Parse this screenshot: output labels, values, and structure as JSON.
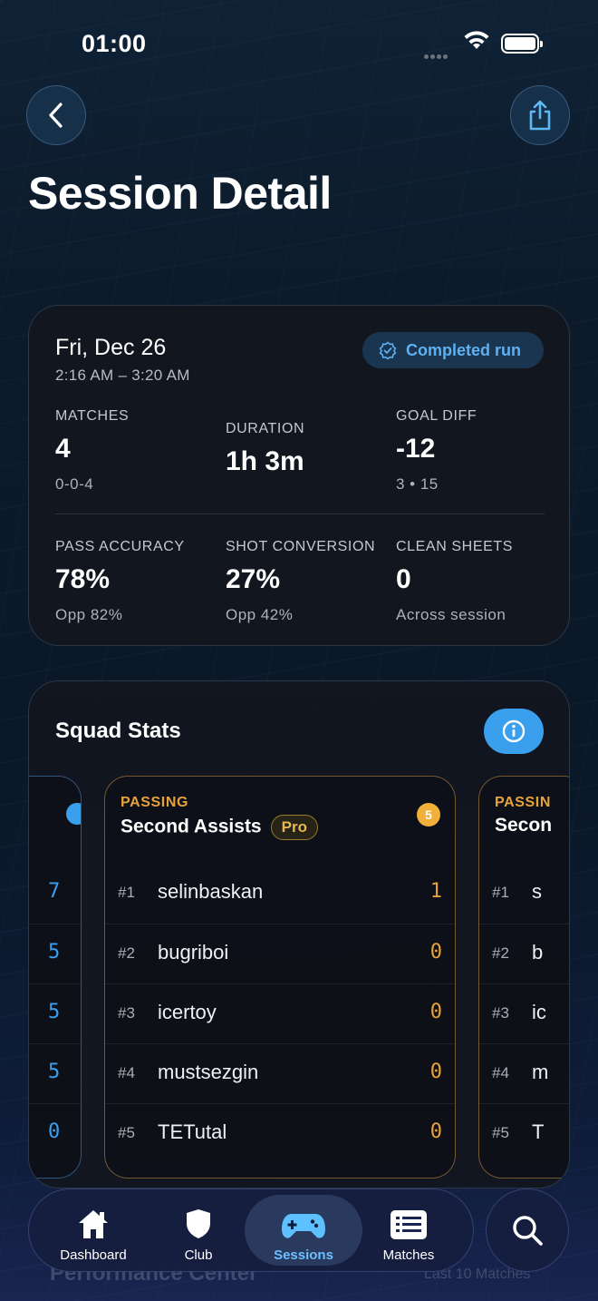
{
  "status_bar": {
    "time": "01:00"
  },
  "header": {
    "title": "Session Detail",
    "back_icon": "chevron-left-icon",
    "share_icon": "share-icon"
  },
  "summary": {
    "date": "Fri, Dec 26",
    "time_range": "2:16 AM – 3:20 AM",
    "badge": "Completed run",
    "stats_row1": [
      {
        "label": "MATCHES",
        "value": "4",
        "sub": "0-0-4"
      },
      {
        "label": "DURATION",
        "value": "1h 3m",
        "sub": ""
      },
      {
        "label": "GOAL DIFF",
        "value": "-12",
        "sub": "3 • 15"
      }
    ],
    "stats_row2": [
      {
        "label": "PASS ACCURACY",
        "value": "78%",
        "sub": "Opp 82%"
      },
      {
        "label": "SHOT CONVERSION",
        "value": "27%",
        "sub": "Opp 42%"
      },
      {
        "label": "CLEAN SHEETS",
        "value": "0",
        "sub": "Across session"
      }
    ]
  },
  "squad": {
    "title": "Squad Stats",
    "left_card": {
      "scores": [
        "7",
        "5",
        "5",
        "5",
        "0"
      ]
    },
    "main_card": {
      "category": "PASSING",
      "name": "Second Assists",
      "pro": "Pro",
      "count": "5",
      "rows": [
        {
          "rank": "#1",
          "player": "selinbaskan",
          "score": "1"
        },
        {
          "rank": "#2",
          "player": "bugriboi",
          "score": "0"
        },
        {
          "rank": "#3",
          "player": "icertoy",
          "score": "0"
        },
        {
          "rank": "#4",
          "player": "mustsezgin",
          "score": "0"
        },
        {
          "rank": "#5",
          "player": "TETutal",
          "score": "0"
        }
      ]
    },
    "right_card": {
      "category": "PASSIN",
      "name": "Secon",
      "rows": [
        {
          "rank": "#1",
          "player": "s"
        },
        {
          "rank": "#2",
          "player": "b"
        },
        {
          "rank": "#3",
          "player": "ic"
        },
        {
          "rank": "#4",
          "player": "m"
        },
        {
          "rank": "#5",
          "player": "T"
        }
      ]
    }
  },
  "background_text": {
    "left": "Performance Center",
    "right": "Last 10 Matches"
  },
  "tabbar": {
    "tabs": [
      {
        "label": "Dashboard",
        "icon": "house-icon"
      },
      {
        "label": "Club",
        "icon": "shield-icon"
      },
      {
        "label": "Sessions",
        "icon": "gamepad-icon",
        "active": true
      },
      {
        "label": "Matches",
        "icon": "list-icon"
      }
    ]
  },
  "colors": {
    "accent_blue": "#3aa0ee",
    "accent_gold": "#e8a23a"
  }
}
